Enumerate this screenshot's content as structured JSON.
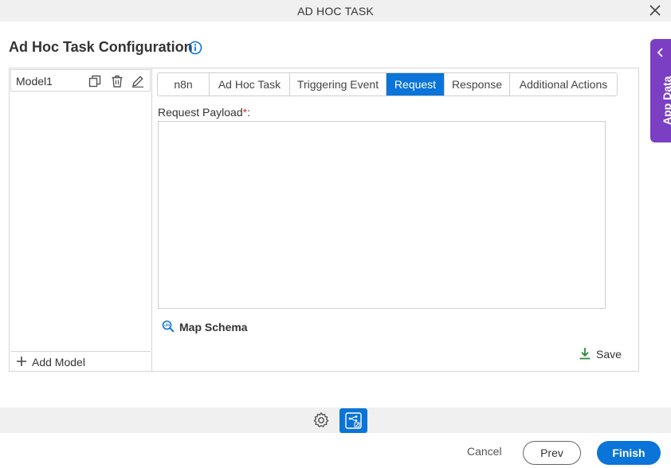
{
  "window": {
    "title": "AD HOC TASK"
  },
  "page": {
    "title": "Ad Hoc Task Configuration"
  },
  "app_data": {
    "label": "App Data"
  },
  "models": {
    "items": [
      {
        "name": "Model1"
      }
    ],
    "add_label": "Add Model"
  },
  "tabs": [
    {
      "label": "n8n",
      "active": false
    },
    {
      "label": "Ad Hoc Task",
      "active": false
    },
    {
      "label": "Triggering Event",
      "active": false
    },
    {
      "label": "Request",
      "active": true
    },
    {
      "label": "Response",
      "active": false
    },
    {
      "label": "Additional Actions",
      "active": false
    }
  ],
  "request": {
    "payload_label": "Request Payload",
    "required_marker": "*",
    "label_suffix": ":",
    "payload_value": ""
  },
  "actions": {
    "map_schema": "Map Schema",
    "save": "Save"
  },
  "footer": {
    "cancel": "Cancel",
    "prev": "Prev",
    "finish": "Finish"
  },
  "colors": {
    "accent": "#0b74d8",
    "app_data_bg": "#7b3fc4",
    "required": "#d9342b",
    "save_icon": "#2e8b3a"
  }
}
